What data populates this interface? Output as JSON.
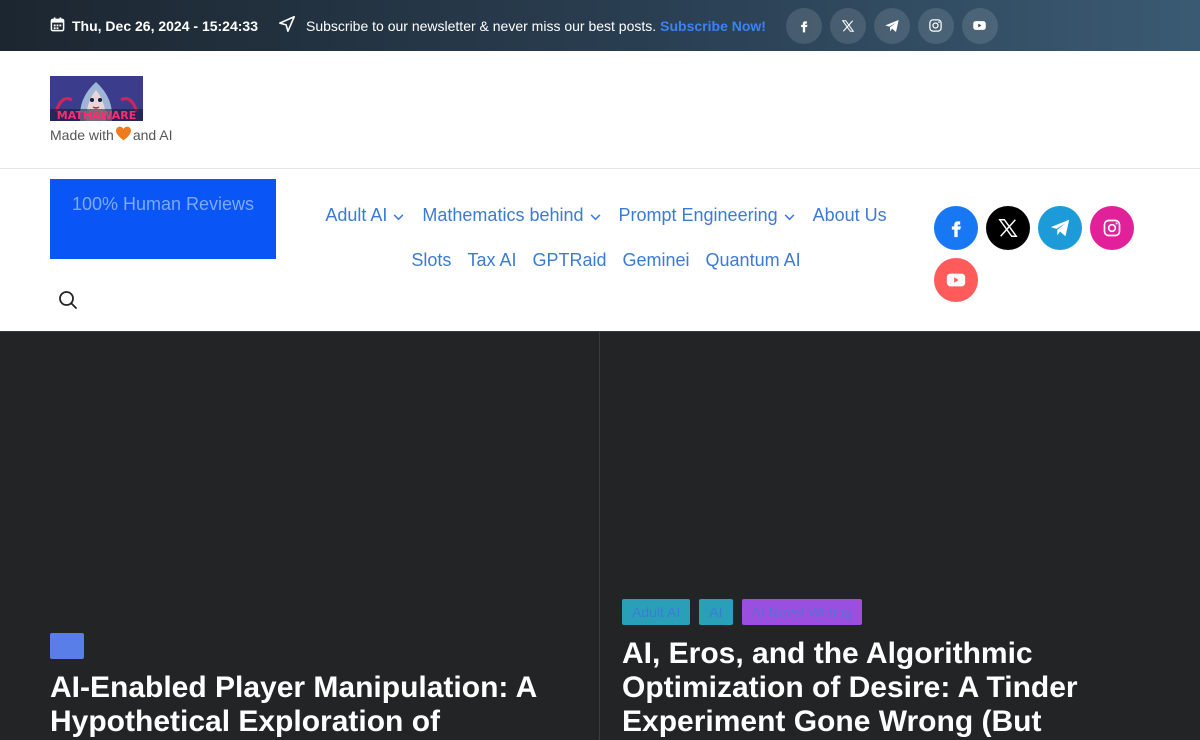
{
  "topbar": {
    "datetime": "Thu, Dec 26, 2024 - 15:24:33",
    "newsletter_text": "Subscribe to our newsletter & never miss our best posts.",
    "subscribe_link": "Subscribe Now!",
    "social": [
      "facebook-icon",
      "x-icon",
      "telegram-icon",
      "instagram-icon",
      "youtube-icon"
    ]
  },
  "brand": {
    "logo_text": "MATHAWARE",
    "tagline_before": "Made with",
    "tagline_after": "and AI"
  },
  "cta": {
    "label": "100% Human Reviews"
  },
  "nav": {
    "row1": [
      {
        "label": "Adult AI",
        "dropdown": true
      },
      {
        "label": "Mathematics behind",
        "dropdown": true
      },
      {
        "label": "Prompt Engineering",
        "dropdown": true
      },
      {
        "label": "About Us",
        "dropdown": false
      }
    ],
    "row2": [
      "Slots",
      "Tax AI",
      "GPTRaid",
      "Geminei",
      "Quantum AI"
    ]
  },
  "colors": {
    "accent": "#0a55f5",
    "nav_link": "#3b7bd6",
    "hero_bg": "#232425"
  },
  "hero": {
    "card1": {
      "tag": "",
      "title": "AI-Enabled Player Manipulation: A Hypothetical Exploration of"
    },
    "card2": {
      "tags": [
        "Adult AI",
        "AI",
        "AI Novel Writing"
      ],
      "title": "AI, Eros, and the Algorithmic Optimization of Desire: A Tinder Experiment Gone Wrong (But"
    }
  }
}
